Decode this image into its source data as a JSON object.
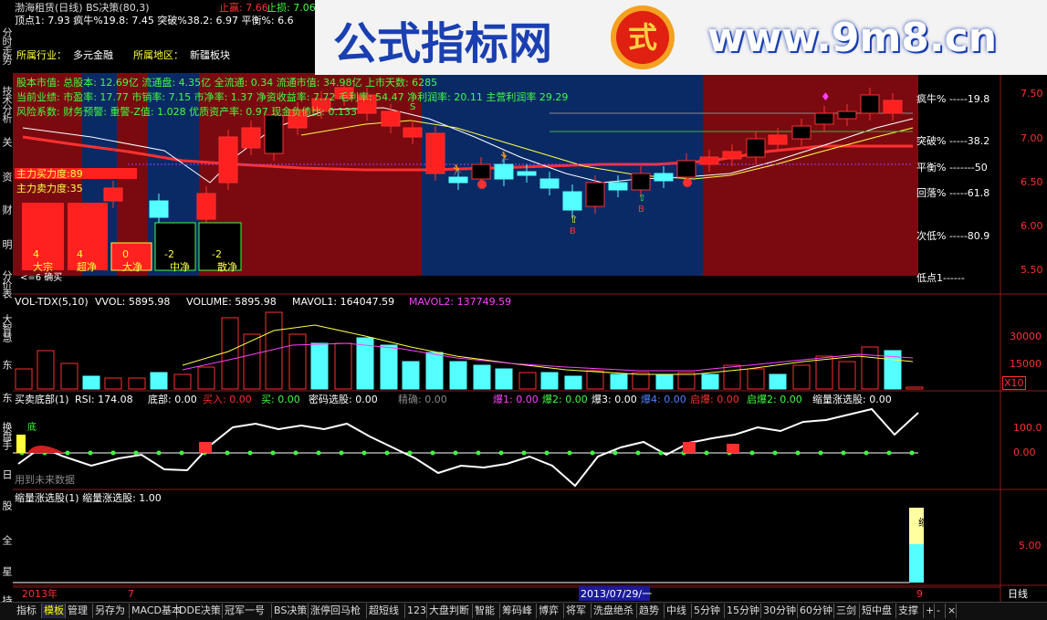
{
  "window": {
    "title": "渤海租赁(日线) BS决策(80,3)",
    "stop_profit_label": "止赢: 7.66",
    "stop_loss_label": "止损: 7.06"
  },
  "top_indicators": {
    "line": "顶点1: 7.93 疯牛%19.8: 7.45 突破%38.2: 6.97 平衡%: 6.6"
  },
  "watermark": {
    "cn": "公式指标网",
    "logo_char": "式",
    "url": "www.9m8.cn"
  },
  "info_panel": {
    "industry_label": "所属行业：",
    "industry": "多元金融",
    "region_label": "所属地区：",
    "region": "新疆板块",
    "line1": "股本市值: 总股本: 12.69亿 流通盘: 4.35亿 全流通: 0.34 流通市值: 34.98亿 上市天数: 6285",
    "line2": "当前业绩: 市盈率: 17.77 市销率: 7.15 市净率: 1.37 净资收益率: 7.72 毛利率: 54.47 净利润率: 20.11 主营利润率 29.29",
    "line3": "风险系数: 财务预警: 重警-Z值: 1.028 优质资产率: 0.97 现金负债比: 0.133"
  },
  "force_panel": {
    "buy_force": "主力买力度:89",
    "sell_force": "主力卖力度:35",
    "bars": [
      {
        "num": "4",
        "label": "大宗"
      },
      {
        "num": "4",
        "label": "超净"
      },
      {
        "num": "0",
        "label": "大净"
      },
      {
        "num": "-2",
        "label": "中净"
      },
      {
        "num": "-2",
        "label": "散净"
      }
    ],
    "bottom_label": "<=6 确买"
  },
  "right_levels": [
    {
      "label": "疯牛% -----19.8"
    },
    {
      "label": "突破% -----38.2"
    },
    {
      "label": "平衡% -------50"
    },
    {
      "label": "回落% -----61.8"
    },
    {
      "label": "次低% -----80.9"
    },
    {
      "label": "低点1------"
    }
  ],
  "price_axis": [
    "7.50",
    "7.00",
    "6.50",
    "6.00",
    "5.50"
  ],
  "vol_panel": {
    "header": {
      "name": "VOL-TDX(5,10)",
      "vvol": "VVOL: 5895.98",
      "volume": "VOLUME: 5895.98",
      "mavol1": "MAVOL1: 164047.59",
      "mavol2": "MAVOL2: 137749.59"
    },
    "axis": [
      "30000",
      "15000"
    ],
    "unit": "X10"
  },
  "rsi_panel": {
    "header": {
      "name": "买卖底部(1)",
      "rsi": "RSI: 174.08",
      "bottom": "底部: 0.00",
      "buyin": "买入: 0.00",
      "buy": "买: 0.00",
      "secret": "密码选股: 0.00",
      "precise": "精确: 0.00",
      "burst1": "爆1: 0.00",
      "burst2": "爆2: 0.00",
      "burst3": "爆3: 0.00",
      "burst4": "爆4: 0.00",
      "qibao": "启爆: 0.00",
      "qibao2": "启爆2: 0.00",
      "suoliang": "缩量涨选股: 0.00"
    },
    "axis": [
      "100.0",
      "0.00"
    ],
    "note": "用到未来数据",
    "marker": "底"
  },
  "shrink_panel": {
    "header": "缩量涨选股(1) 缩量涨选股: 1.00",
    "axis": [
      "5.00"
    ],
    "bar_label": "缩量"
  },
  "date_axis": {
    "year": "2013年",
    "mark1": "7",
    "cursor_date": "2013/07/29/一",
    "mark2": "9",
    "period": "日线"
  },
  "left_bar": [
    "分时走势",
    "技术分析",
    "关",
    "资",
    "财",
    "明",
    "分价表",
    "大智慧",
    "东",
    "东",
    "换盘手",
    "日",
    "股",
    "全",
    "星",
    "持"
  ],
  "tabs": [
    "指标",
    "模板",
    "管理",
    "另存为",
    "MACD基本",
    "DDE决策",
    "冠军一号",
    "BS决策",
    "涨停回马枪",
    "超短线",
    "123",
    "大盘判断",
    "智能",
    "筹码峰",
    "博弈",
    "将军",
    "洗盘绝杀",
    "趋势",
    "中线",
    "5分钟",
    "15分钟",
    "30分钟",
    "60分钟",
    "三剑",
    "短中盘",
    "支撑",
    "+",
    "-",
    "×"
  ],
  "colors": {
    "up": "#ff3030",
    "down": "#54ffff",
    "bg_red": "#7a0a10",
    "bg_blue": "#0a2a66",
    "ma_white": "#ffffff",
    "ma_yellow": "#ffff40",
    "ma_red": "#ff3030",
    "magenta": "#ff40ff"
  }
}
